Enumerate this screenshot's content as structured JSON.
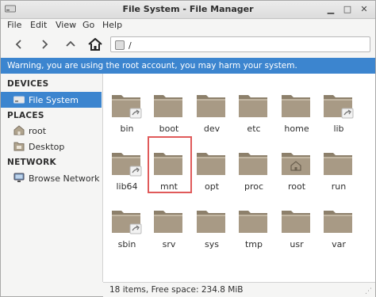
{
  "window": {
    "title": "File System - File Manager"
  },
  "menu": [
    "File",
    "Edit",
    "View",
    "Go",
    "Help"
  ],
  "toolbar": {
    "path": "/"
  },
  "warning": "Warning, you are using the root account, you may harm your system.",
  "sidebar": {
    "devices_label": "DEVICES",
    "places_label": "PLACES",
    "network_label": "NETWORK",
    "devices": [
      "File System"
    ],
    "places": [
      "root",
      "Desktop"
    ],
    "network": [
      "Browse Network"
    ]
  },
  "files": [
    "bin",
    "boot",
    "dev",
    "etc",
    "home",
    "lib",
    "lib64",
    "mnt",
    "opt",
    "proc",
    "root",
    "run",
    "sbin",
    "srv",
    "sys",
    "tmp",
    "usr",
    "var"
  ],
  "status": "18 items, Free space: 234.8 MiB",
  "colors": {
    "accent": "#3c85cf",
    "folder": "#a89a85",
    "highlight": "#e05a5a"
  }
}
